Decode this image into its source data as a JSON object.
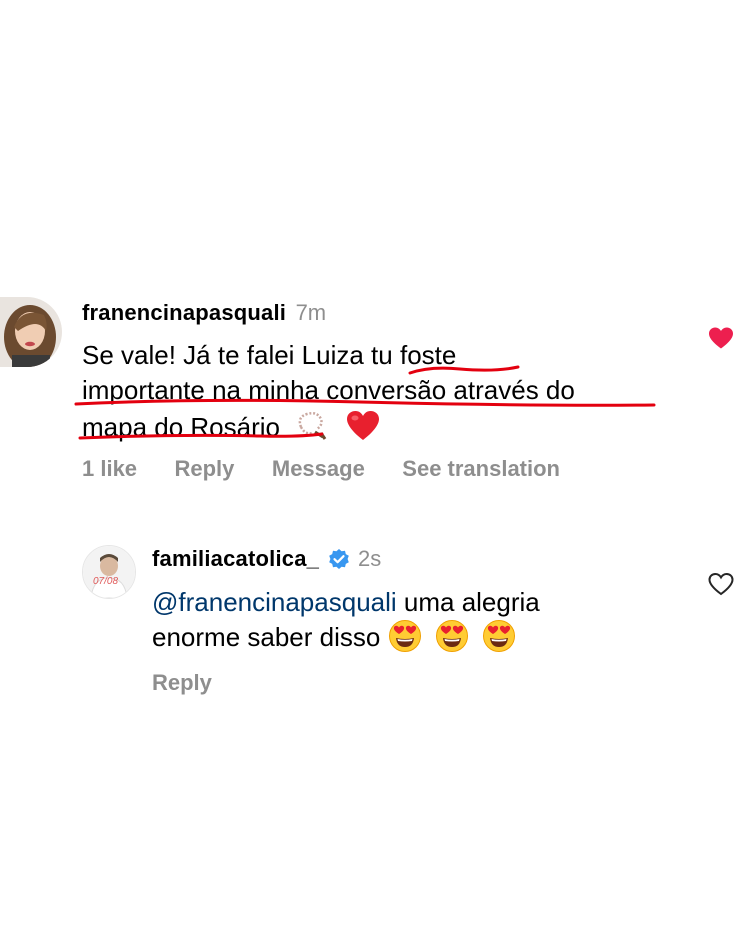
{
  "comment": {
    "username": "franencinapasquali",
    "time": "7m",
    "line1": "Se vale! Já te falei Luiza tu foste",
    "line2": "importante na minha conversão através do",
    "line3": "mapa do Rosário",
    "likes": "1 like",
    "reply_label": "Reply",
    "message_label": "Message",
    "translate_label": "See translation",
    "liked": true,
    "heart_color": "#ed1f4f"
  },
  "reply": {
    "username": "familiacatolica_",
    "verified": true,
    "time": "2s",
    "mention": "@franencinapasquali",
    "text1": " uma alegria",
    "text2": "enorme saber disso",
    "reply_label": "Reply",
    "avatar_caption": "07/08",
    "mention_color": "#00376b",
    "verified_color": "#3897f0"
  },
  "annotation_color": "#e3000f"
}
